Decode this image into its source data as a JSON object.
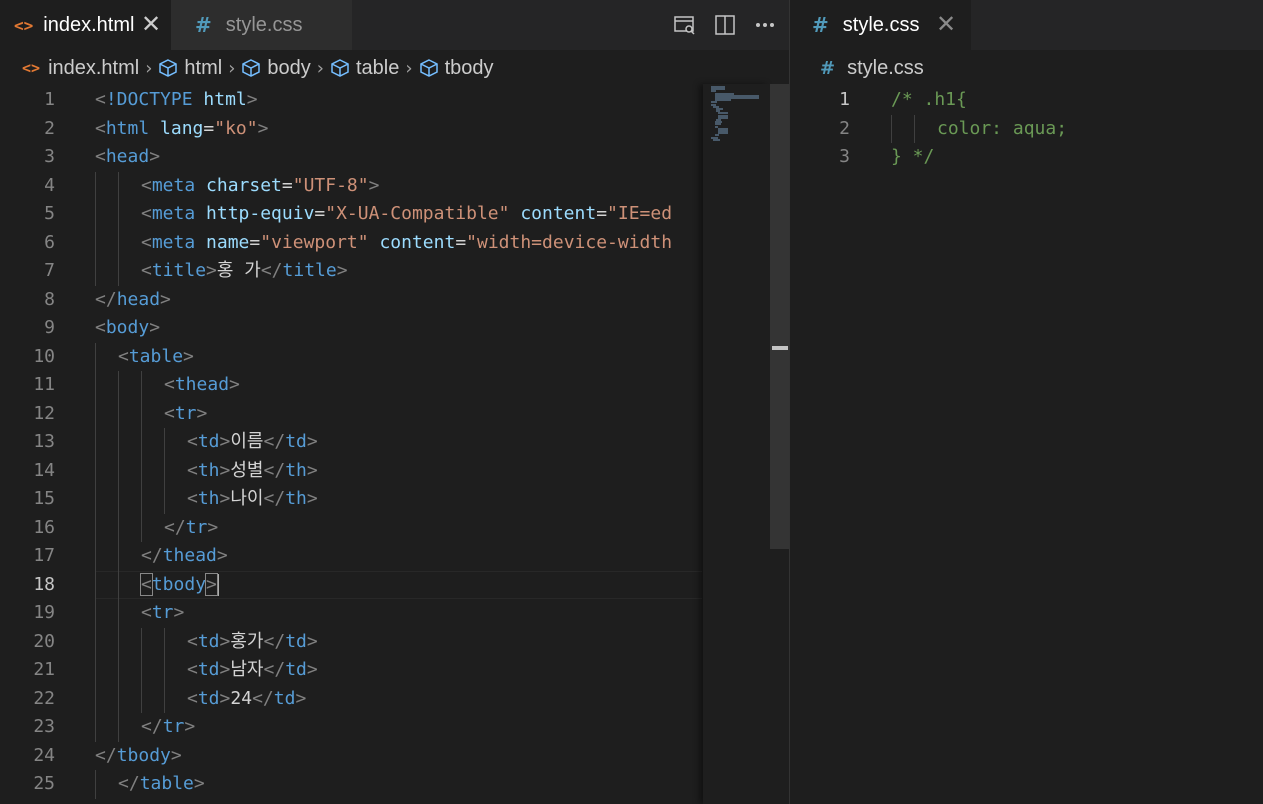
{
  "left": {
    "tabs": [
      {
        "icon": "html-file-icon",
        "label": "index.html",
        "active": true
      },
      {
        "icon": "css-file-icon",
        "label": "style.css",
        "active": false
      }
    ],
    "breadcrumb": {
      "file": "index.html",
      "items": [
        "html",
        "body",
        "table",
        "tbody"
      ]
    },
    "lines": [
      {
        "n": "1",
        "indent": 0,
        "tokens": [
          [
            "b",
            "<"
          ],
          [
            "tag",
            "!DOCTYPE "
          ],
          [
            "attr",
            "html"
          ],
          [
            "b",
            ">"
          ]
        ]
      },
      {
        "n": "2",
        "indent": 0,
        "tokens": [
          [
            "b",
            "<"
          ],
          [
            "tag",
            "html "
          ],
          [
            "attr",
            "lang"
          ],
          [
            "text",
            "="
          ],
          [
            "str",
            "\"ko\""
          ],
          [
            "b",
            ">"
          ]
        ]
      },
      {
        "n": "3",
        "indent": 0,
        "tokens": [
          [
            "b",
            "<"
          ],
          [
            "tag",
            "head"
          ],
          [
            "b",
            ">"
          ]
        ]
      },
      {
        "n": "4",
        "indent": 2,
        "tokens": [
          [
            "b",
            "<"
          ],
          [
            "tag",
            "meta "
          ],
          [
            "attr",
            "charset"
          ],
          [
            "text",
            "="
          ],
          [
            "str",
            "\"UTF-8\""
          ],
          [
            "b",
            ">"
          ]
        ]
      },
      {
        "n": "5",
        "indent": 2,
        "tokens": [
          [
            "b",
            "<"
          ],
          [
            "tag",
            "meta "
          ],
          [
            "attr",
            "http-equiv"
          ],
          [
            "text",
            "="
          ],
          [
            "str",
            "\"X-UA-Compatible\""
          ],
          [
            "text",
            " "
          ],
          [
            "attr",
            "content"
          ],
          [
            "text",
            "="
          ],
          [
            "str",
            "\"IE=ed"
          ]
        ]
      },
      {
        "n": "6",
        "indent": 2,
        "tokens": [
          [
            "b",
            "<"
          ],
          [
            "tag",
            "meta "
          ],
          [
            "attr",
            "name"
          ],
          [
            "text",
            "="
          ],
          [
            "str",
            "\"viewport\""
          ],
          [
            "text",
            " "
          ],
          [
            "attr",
            "content"
          ],
          [
            "text",
            "="
          ],
          [
            "str",
            "\"width=device-width"
          ]
        ]
      },
      {
        "n": "7",
        "indent": 2,
        "tokens": [
          [
            "b",
            "<"
          ],
          [
            "tag",
            "title"
          ],
          [
            "b",
            ">"
          ],
          [
            "text",
            "홍 가"
          ],
          [
            "b",
            "</"
          ],
          [
            "tag",
            "title"
          ],
          [
            "b",
            ">"
          ]
        ]
      },
      {
        "n": "8",
        "indent": 0,
        "tokens": [
          [
            "b",
            "</"
          ],
          [
            "tag",
            "head"
          ],
          [
            "b",
            ">"
          ]
        ]
      },
      {
        "n": "9",
        "indent": 0,
        "tokens": [
          [
            "b",
            "<"
          ],
          [
            "tag",
            "body"
          ],
          [
            "b",
            ">"
          ]
        ]
      },
      {
        "n": "10",
        "indent": 1,
        "tokens": [
          [
            "b",
            "<"
          ],
          [
            "tag",
            "table"
          ],
          [
            "b",
            ">"
          ]
        ]
      },
      {
        "n": "11",
        "indent": 3,
        "tokens": [
          [
            "b",
            "<"
          ],
          [
            "tag",
            "thead"
          ],
          [
            "b",
            ">"
          ]
        ]
      },
      {
        "n": "12",
        "indent": 3,
        "tokens": [
          [
            "b",
            "<"
          ],
          [
            "tag",
            "tr"
          ],
          [
            "b",
            ">"
          ]
        ]
      },
      {
        "n": "13",
        "indent": 4,
        "tokens": [
          [
            "b",
            "<"
          ],
          [
            "tag",
            "td"
          ],
          [
            "b",
            ">"
          ],
          [
            "text",
            "이름"
          ],
          [
            "b",
            "</"
          ],
          [
            "tag",
            "td"
          ],
          [
            "b",
            ">"
          ]
        ]
      },
      {
        "n": "14",
        "indent": 4,
        "tokens": [
          [
            "b",
            "<"
          ],
          [
            "tag",
            "th"
          ],
          [
            "b",
            ">"
          ],
          [
            "text",
            "성별"
          ],
          [
            "b",
            "</"
          ],
          [
            "tag",
            "th"
          ],
          [
            "b",
            ">"
          ]
        ]
      },
      {
        "n": "15",
        "indent": 4,
        "tokens": [
          [
            "b",
            "<"
          ],
          [
            "tag",
            "th"
          ],
          [
            "b",
            ">"
          ],
          [
            "text",
            "나이"
          ],
          [
            "b",
            "</"
          ],
          [
            "tag",
            "th"
          ],
          [
            "b",
            ">"
          ]
        ]
      },
      {
        "n": "16",
        "indent": 3,
        "tokens": [
          [
            "b",
            "</"
          ],
          [
            "tag",
            "tr"
          ],
          [
            "b",
            ">"
          ]
        ]
      },
      {
        "n": "17",
        "indent": 2,
        "tokens": [
          [
            "b",
            "</"
          ],
          [
            "tag",
            "thead"
          ],
          [
            "b",
            ">"
          ]
        ]
      },
      {
        "n": "18",
        "indent": 2,
        "tokens": [
          [
            "box",
            "<"
          ],
          [
            "tag",
            "tbody"
          ],
          [
            "box",
            ">"
          ]
        ]
      },
      {
        "n": "19",
        "indent": 2,
        "tokens": [
          [
            "b",
            "<"
          ],
          [
            "tag",
            "tr"
          ],
          [
            "b",
            ">"
          ]
        ]
      },
      {
        "n": "20",
        "indent": 4,
        "tokens": [
          [
            "b",
            "<"
          ],
          [
            "tag",
            "td"
          ],
          [
            "b",
            ">"
          ],
          [
            "text",
            "홍가"
          ],
          [
            "b",
            "</"
          ],
          [
            "tag",
            "td"
          ],
          [
            "b",
            ">"
          ]
        ]
      },
      {
        "n": "21",
        "indent": 4,
        "tokens": [
          [
            "b",
            "<"
          ],
          [
            "tag",
            "td"
          ],
          [
            "b",
            ">"
          ],
          [
            "text",
            "남자"
          ],
          [
            "b",
            "</"
          ],
          [
            "tag",
            "td"
          ],
          [
            "b",
            ">"
          ]
        ]
      },
      {
        "n": "22",
        "indent": 4,
        "tokens": [
          [
            "b",
            "<"
          ],
          [
            "tag",
            "td"
          ],
          [
            "b",
            ">"
          ],
          [
            "text",
            "24"
          ],
          [
            "b",
            "</"
          ],
          [
            "tag",
            "td"
          ],
          [
            "b",
            ">"
          ]
        ]
      },
      {
        "n": "23",
        "indent": 2,
        "tokens": [
          [
            "b",
            "</"
          ],
          [
            "tag",
            "tr"
          ],
          [
            "b",
            ">"
          ]
        ]
      },
      {
        "n": "24",
        "indent": 0,
        "tokens": [
          [
            "b",
            "</"
          ],
          [
            "tag",
            "tbody"
          ],
          [
            "b",
            ">"
          ]
        ]
      },
      {
        "n": "25",
        "indent": 1,
        "tokens": [
          [
            "b",
            "</"
          ],
          [
            "tag",
            "table"
          ],
          [
            "b",
            ">"
          ]
        ]
      }
    ],
    "current_line": "18"
  },
  "right": {
    "tabs": [
      {
        "icon": "css-file-icon",
        "label": "style.css",
        "active": true
      }
    ],
    "breadcrumb": {
      "file": "style.css"
    },
    "lines": [
      {
        "n": "1",
        "indent": 0,
        "tokens": [
          [
            "comment",
            "/* .h1{"
          ]
        ]
      },
      {
        "n": "2",
        "indent": 2,
        "tokens": [
          [
            "comment",
            "color: aqua;"
          ]
        ]
      },
      {
        "n": "3",
        "indent": 0,
        "tokens": [
          [
            "comment",
            "} */"
          ]
        ]
      }
    ],
    "current_line": "1"
  },
  "colors": {
    "tag": "#569cd6",
    "attr": "#9cdcfe",
    "string": "#ce9178",
    "comment": "#6a9955",
    "bracket": "#808080",
    "html_icon": "#e37933",
    "css_icon": "#519aba"
  }
}
